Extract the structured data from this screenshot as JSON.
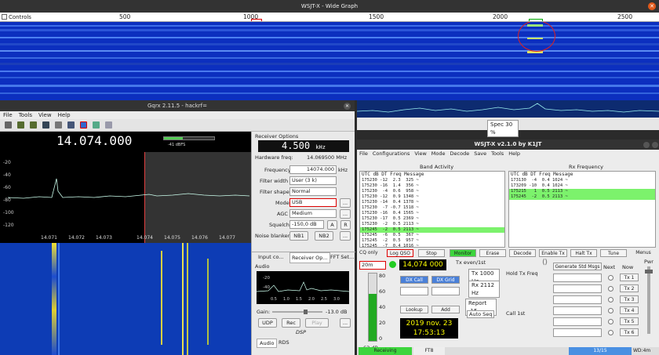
{
  "wide_graph": {
    "title": "WSJT-X - Wide Graph",
    "controls_label": "Controls",
    "close_label": "✕",
    "ticks": [
      "500",
      "1000",
      "1500",
      "2000",
      "2500"
    ]
  },
  "wide_graph_controls": {
    "spec_label": "Spec 30 %"
  },
  "gqrx": {
    "title": "Gqrx 2.11.5 - hackrf=",
    "menu": [
      "File",
      "Tools",
      "View",
      "Help"
    ],
    "frequency_display": "14.074.000",
    "db_scale": [
      "-41 dBFS"
    ],
    "db_ticks": [
      "-20",
      "-40",
      "-60",
      "-80",
      "-100",
      "-120"
    ],
    "freq_ticks": [
      "14.071",
      "14.072",
      "14.073",
      "14.074",
      "14.075",
      "14.076",
      "14.077"
    ],
    "receiver_options": {
      "title": "Receiver Options",
      "filter_offset": "4.500",
      "filter_unit": "kHz",
      "hw_freq_label": "Hardware freq:",
      "hw_freq_value": "14.069500 MHz",
      "frequency_label": "Frequency",
      "frequency_value": "14074.000",
      "frequency_unit": "kHz",
      "filter_width_label": "Filter width",
      "filter_width_value": "User (3 k)",
      "filter_shape_label": "Filter shape",
      "filter_shape_value": "Normal",
      "mode_label": "Mode",
      "mode_value": "USB",
      "agc_label": "AGC",
      "agc_value": "Medium",
      "squelch_label": "Squelch",
      "squelch_value": "-150,0 dB",
      "squelch_btn_a": "A",
      "squelch_btn_r": "R",
      "noise_blanker_label": "Noise blanker",
      "nb1": "NB1",
      "nb2": "NB2",
      "more": "..."
    },
    "tabs": [
      "Input co...",
      "Receiver Op...",
      "FFT Set..."
    ],
    "audio": {
      "title": "Audio",
      "db_ticks": [
        "-20",
        "-40"
      ],
      "freq_ticks": [
        "0.5",
        "1.0",
        "1.5",
        "2.0",
        "2.5",
        "3.0"
      ],
      "gain_label": "Gain:",
      "gain_value": "-13.0 dB",
      "udp": "UDP",
      "rec": "Rec",
      "play": "Play",
      "more": "...",
      "dsp_label": "DSP",
      "bottom_tabs": [
        "Audio",
        "RDS"
      ]
    }
  },
  "wsjtx": {
    "title": "WSJT-X   v2.1.0   by K1JT",
    "menu": [
      "File",
      "Configurations",
      "View",
      "Mode",
      "Decode",
      "Save",
      "Tools",
      "Help"
    ],
    "band_activity_title": "Band Activity",
    "rx_frequency_title": "Rx Frequency",
    "band_header": "UTC   dB   DT Freq    Message",
    "rx_header": "UTC   dB   DT Freq    Message",
    "band_rows": [
      {
        "t": "175230 -12  2.3  325 ~",
        "hl": false
      },
      {
        "t": "175230 -16  1.4  356 ~",
        "hl": false
      },
      {
        "t": "175230  -4  0.6  958 ~",
        "hl": false
      },
      {
        "t": "175230 -12  0.9 1348 ~",
        "hl": false
      },
      {
        "t": "175230 -14  0.4 1378 ~",
        "hl": false
      },
      {
        "t": "175230  -7 -0.7 1518 ~",
        "hl": false
      },
      {
        "t": "175230 -16  0.4 1565 ~",
        "hl": false
      },
      {
        "t": "175230 -17  0.5 2369 ~",
        "hl": false
      },
      {
        "t": "175230  -2  0.5 2113 ~",
        "hl": false
      },
      {
        "t": "175245  -2  0.5 2113 ~",
        "hl": true
      },
      {
        "t": "175245  -6  0.5  367 ~",
        "hl": false
      },
      {
        "t": "175245  -2  0.5  957 ~",
        "hl": false
      },
      {
        "t": "175245  -7  0.4 1016 ~",
        "hl": false
      },
      {
        "t": "175245 -10  0.5 2371 ~",
        "hl": false
      }
    ],
    "rx_rows": [
      {
        "t": "173130  -4  0.4 1024 ~",
        "hl": false
      },
      {
        "t": "173209 -10  0.4 1024 ~",
        "hl": false
      },
      {
        "t": "175215   1  0.5 2113 ~",
        "hl": true
      },
      {
        "t": "175245  -2  0.5 2113 ~",
        "hl": true
      }
    ],
    "buttons": {
      "cq_only": "CQ only",
      "log_qso": "Log QSO",
      "stop": "Stop",
      "monitor": "Monitor",
      "erase": "Erase",
      "decode": "Decode",
      "enable_tx": "Enable Tx",
      "halt_tx": "Halt Tx",
      "tune": "Tune",
      "menus": "Menus"
    },
    "band": "20m",
    "dial_freq": "14,074 000",
    "tx_even": "Tx even/1st",
    "tx_hz": "Tx 1000 Hz",
    "rx_hz": "Rx 2112 Hz",
    "hold_tx": "Hold Tx Freq",
    "report": "Report -15",
    "auto_seq": "Auto Seq",
    "call_1st": "Call 1st",
    "dx_call": "DX Call",
    "dx_grid": "DX Grid",
    "lookup": "Lookup",
    "add": "Add",
    "date": "2019 nov. 23",
    "time": "17:53:13",
    "db_label": "63 dB",
    "meter_ticks": [
      "80",
      "60",
      "40",
      "20",
      "0"
    ],
    "gen_std": "Generate Std Msgs",
    "next": "Next",
    "now": "Now",
    "tx_buttons": [
      "Tx 1",
      "Tx 2",
      "Tx 3",
      "Tx 4",
      "Tx 5",
      "Tx 6"
    ],
    "pwr": "Pwr",
    "status": {
      "receiving": "Receiving",
      "mode": "FT8",
      "progress": "13/15",
      "wd": "WD:4m"
    }
  }
}
